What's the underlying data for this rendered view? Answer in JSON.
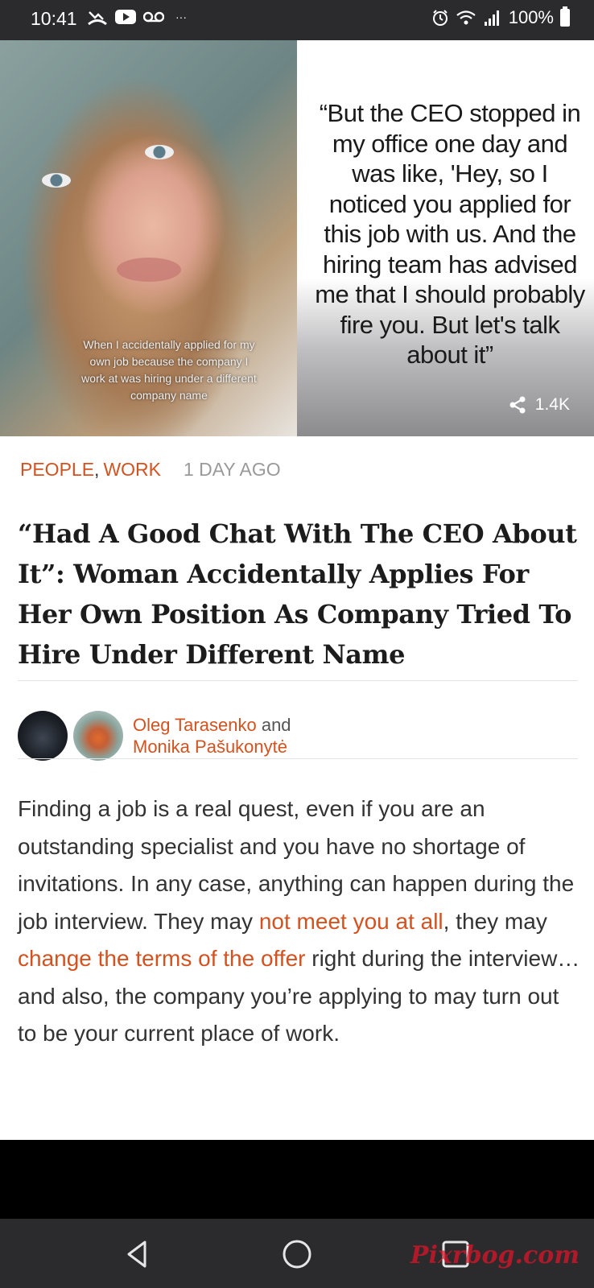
{
  "status_bar": {
    "time": "10:41",
    "battery": "100%",
    "left_icons": [
      "missed-call-icon",
      "youtube-icon",
      "voicemail-icon",
      "more-dots-icon"
    ],
    "right_icons": [
      "alarm-icon",
      "wifi-icon",
      "signal-icon",
      "battery-icon"
    ],
    "more_dots": "···"
  },
  "hero": {
    "caption": "When I accidentally applied for my own job because the company I work at was hiring under a different company name",
    "quote": "“But the CEO stopped in my office one day and was like, 'Hey, so I noticed you applied for this job with us. And the hiring team has advised me that I should probably fire you. But let's talk about it”",
    "share_count": "1.4K"
  },
  "article": {
    "categories": [
      "PEOPLE",
      "WORK"
    ],
    "category_separator": ",",
    "date": "1 DAY AGO",
    "headline": "“Had A Good Chat With The CEO About It”: Woman Accidentally Applies For Her Own Position As Company Tried To Hire Under Different Name",
    "authors": {
      "first": "Oleg Tarasenko",
      "conjunction": "and",
      "second": "Monika Pašukonytė"
    },
    "body": {
      "part1": "Finding a job is a real quest, even if you are an outstanding specialist and you have no shortage of invitations. In any case, anything can happen during the job interview. They may ",
      "link1": "not meet you at all",
      "part2": ", they may ",
      "link2": "change the terms of the offer",
      "part3": " right during the interview… and also, the company you’re applying to may turn out to be your current place of work."
    }
  },
  "watermark": "Pixrbog.com",
  "colors": {
    "accent": "#d4521f",
    "status_bar": "#2b2b2d",
    "text": "#333333",
    "meta_gray": "#9a9a9a"
  }
}
